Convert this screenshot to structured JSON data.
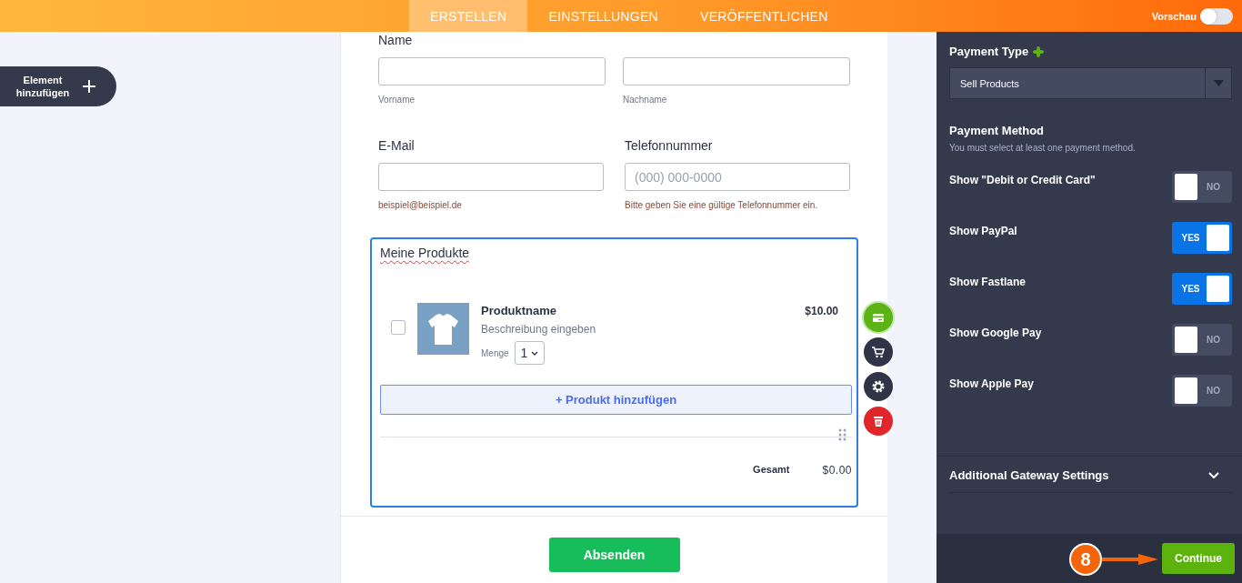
{
  "topbar": {
    "tabs": [
      {
        "label": "ERSTELLEN",
        "selected": true
      },
      {
        "label": "EINSTELLUNGEN",
        "selected": false
      },
      {
        "label": "VERÖFFENTLICHEN",
        "selected": false
      }
    ],
    "preview": {
      "label": "Vorschau",
      "on": false
    }
  },
  "sidebar": {
    "add_button": "Element hinzufügen"
  },
  "form": {
    "name_field": {
      "label": "Name",
      "parts": [
        {
          "sublabel": "Vorname"
        },
        {
          "sublabel": "Nachname"
        }
      ]
    },
    "contact_fields": [
      {
        "label": "E-Mail",
        "sublabel": "beispiel@beispiel.de"
      },
      {
        "label": "Telefonnummer",
        "placeholder": "(000) 000-0000",
        "sublabel": "Bitte geben Sie eine gültige Telefonnummer ein."
      }
    ],
    "products": {
      "title": "Meine Produkte",
      "items": [
        {
          "name": "Produktname",
          "description": "Beschreibung eingeben",
          "price": "$10.00",
          "quantity_label": "Menge",
          "quantity": "1",
          "checked": false
        }
      ],
      "add_button": "+ Produkt hinzufügen",
      "total_label": "Gesamt",
      "total": "$0.00"
    },
    "submit": "Absenden"
  },
  "panel": {
    "payment_type": {
      "label": "Payment Type",
      "value": "Sell Products"
    },
    "payment_method": {
      "label": "Payment Method",
      "hint": "You must select at least one payment method."
    },
    "methods": [
      {
        "label": "Show \"Debit or Credit Card\"",
        "on": false,
        "state_text": "NO"
      },
      {
        "label": "Show PayPal",
        "on": true,
        "state_text": "YES"
      },
      {
        "label": "Show Fastlane",
        "on": true,
        "state_text": "YES"
      },
      {
        "label": "Show Google Pay",
        "on": false,
        "state_text": "NO"
      },
      {
        "label": "Show Apple Pay",
        "on": false,
        "state_text": "NO"
      }
    ],
    "additional": "Additional Gateway Settings",
    "continue": "Continue"
  },
  "callout": {
    "step": "8"
  }
}
